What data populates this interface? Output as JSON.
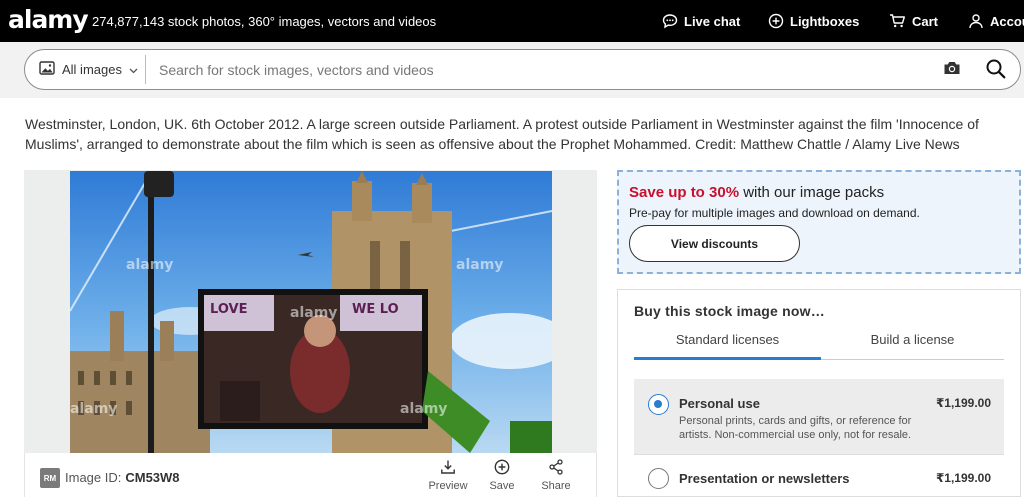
{
  "header": {
    "logo": "alamy",
    "tagline": "274,877,143 stock photos, 360° images, vectors and videos",
    "nav": {
      "live_chat": "Live chat",
      "lightboxes": "Lightboxes",
      "cart": "Cart",
      "account": "Account"
    }
  },
  "search": {
    "scope_label": "All images",
    "placeholder": "Search for stock images, vectors and videos",
    "icons": [
      "image-icon",
      "chevron-down-icon",
      "camera-icon",
      "search-icon"
    ]
  },
  "caption": "Westminster, London, UK. 6th October 2012. A large screen outside Parliament. A protest outside Parliament in Westminster against the film 'Innocence of Muslims', arranged to demonstrate about the film which is seen as offensive about the Prophet Mohammed. Credit: Matthew Chattle / Alamy Live News",
  "image": {
    "watermark": "alamy",
    "screen_text": [
      "LOVE",
      "WE LO"
    ],
    "license_badge": "RM",
    "id_label": "Image ID:",
    "id_value": "CM53W8",
    "actions": {
      "preview": "Preview",
      "save": "Save",
      "share": "Share"
    }
  },
  "discount": {
    "highlight": "Save up to 30%",
    "rest": " with our image packs",
    "subtitle": "Pre-pay for multiple images and download on demand.",
    "button": "View discounts"
  },
  "buy": {
    "title": "Buy this stock image now…",
    "tabs": {
      "standard": "Standard licenses",
      "build": "Build a license"
    },
    "options": [
      {
        "name": "Personal use",
        "description": "Personal prints, cards and gifts, or reference for artists. Non-commercial use only, not for resale.",
        "price": "₹1,199.00",
        "selected": true
      },
      {
        "name": "Presentation or newsletters",
        "description": "",
        "price": "₹1,199.00",
        "selected": false
      }
    ]
  },
  "colors": {
    "topbar": "#000000",
    "accent_red": "#c8102e",
    "accent_blue": "#2b7bd0",
    "discount_bg": "#eef4fb"
  }
}
